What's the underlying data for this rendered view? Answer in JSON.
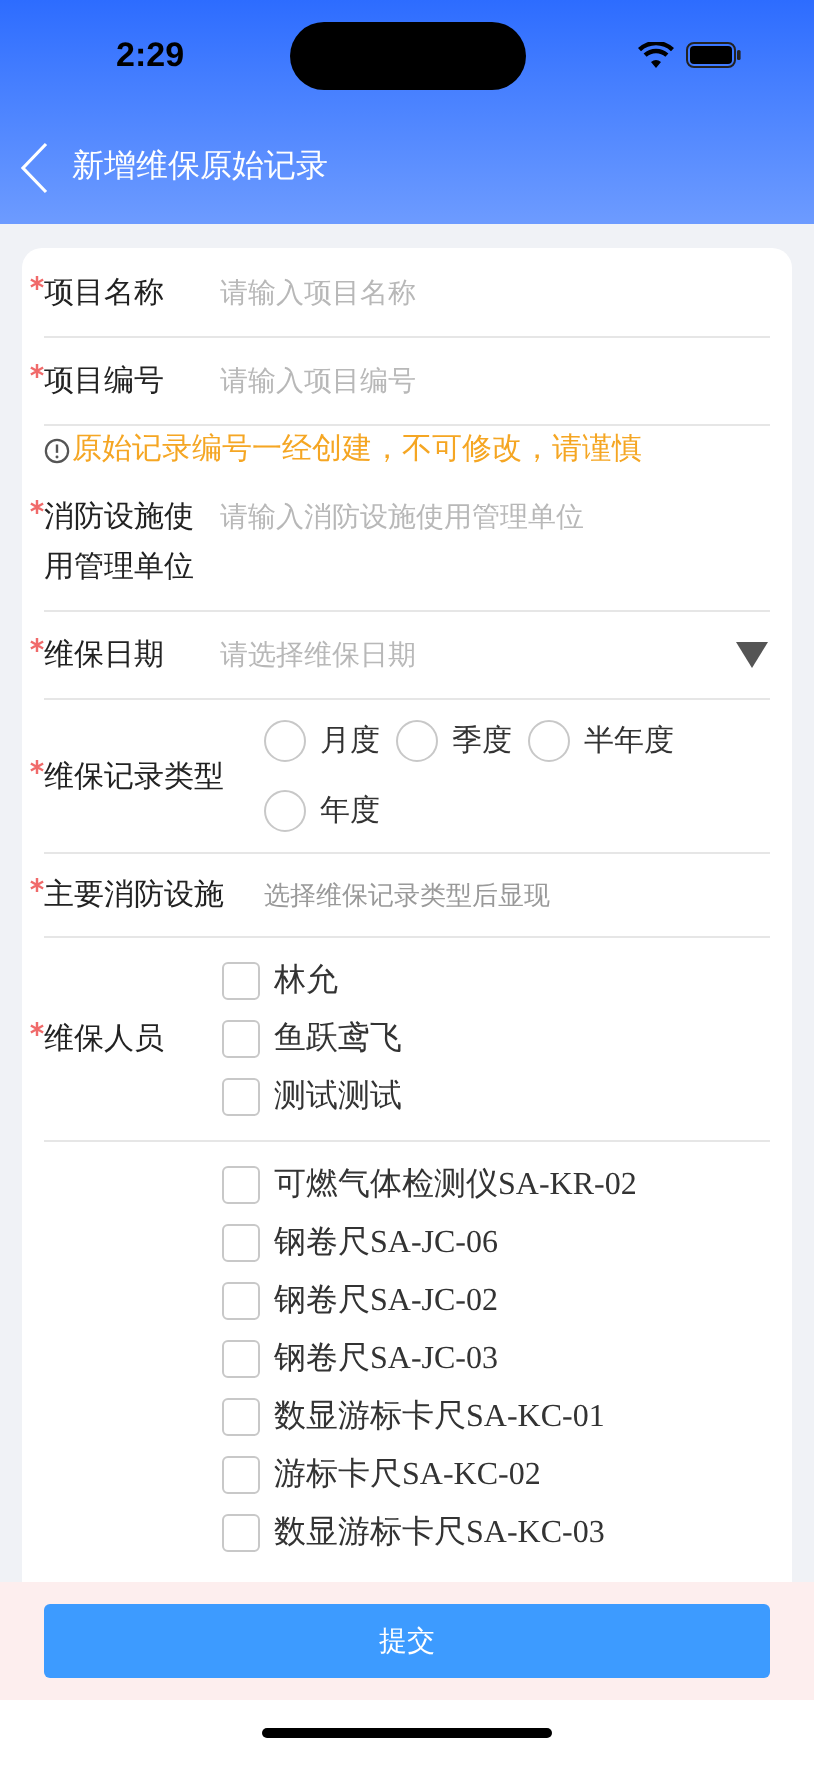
{
  "status_bar": {
    "time": "2:29"
  },
  "nav": {
    "title": "新增维保原始记录"
  },
  "form": {
    "fields": [
      {
        "kind": "text",
        "label": "项目名称",
        "required": true,
        "placeholder": "请输入项目名称"
      },
      {
        "kind": "text",
        "label": "项目编号",
        "required": true,
        "placeholder": "请输入项目编号"
      },
      {
        "kind": "notice",
        "text": "原始记录编号一经创建，不可修改，请谨慎"
      },
      {
        "kind": "text",
        "label": "消防设施使用管理单位",
        "required": true,
        "placeholder": "请输入消防设施使用管理单位"
      },
      {
        "kind": "select",
        "label": "维保日期",
        "required": true,
        "placeholder": "请选择维保日期"
      },
      {
        "kind": "radio",
        "label": "维保记录类型",
        "required": true,
        "options": [
          {
            "label": "月度",
            "selected": false
          },
          {
            "label": "季度",
            "selected": false
          },
          {
            "label": "半年度",
            "selected": false
          },
          {
            "label": "年度",
            "selected": false
          }
        ]
      },
      {
        "kind": "hint",
        "label": "主要消防设施",
        "required": true,
        "text": "选择维保记录类型后显现"
      },
      {
        "kind": "checkbox",
        "label": "维保人员",
        "required": true,
        "options": [
          {
            "label": "林允",
            "checked": false
          },
          {
            "label": "鱼跃鸢飞",
            "checked": false
          },
          {
            "label": "测试测试",
            "checked": false
          }
        ]
      },
      {
        "kind": "equipment",
        "options": [
          {
            "label": "可燃气体检测仪SA-KR-02",
            "checked": false
          },
          {
            "label": "钢卷尺SA-JC-06",
            "checked": false
          },
          {
            "label": "钢卷尺SA-JC-02",
            "checked": false
          },
          {
            "label": "钢卷尺SA-JC-03",
            "checked": false
          },
          {
            "label": "数显游标卡尺SA-KC-01",
            "checked": false
          },
          {
            "label": "游标卡尺SA-KC-02",
            "checked": false
          },
          {
            "label": "数显游标卡尺SA-KC-03",
            "checked": false
          }
        ]
      }
    ]
  },
  "submit_button": "提交"
}
